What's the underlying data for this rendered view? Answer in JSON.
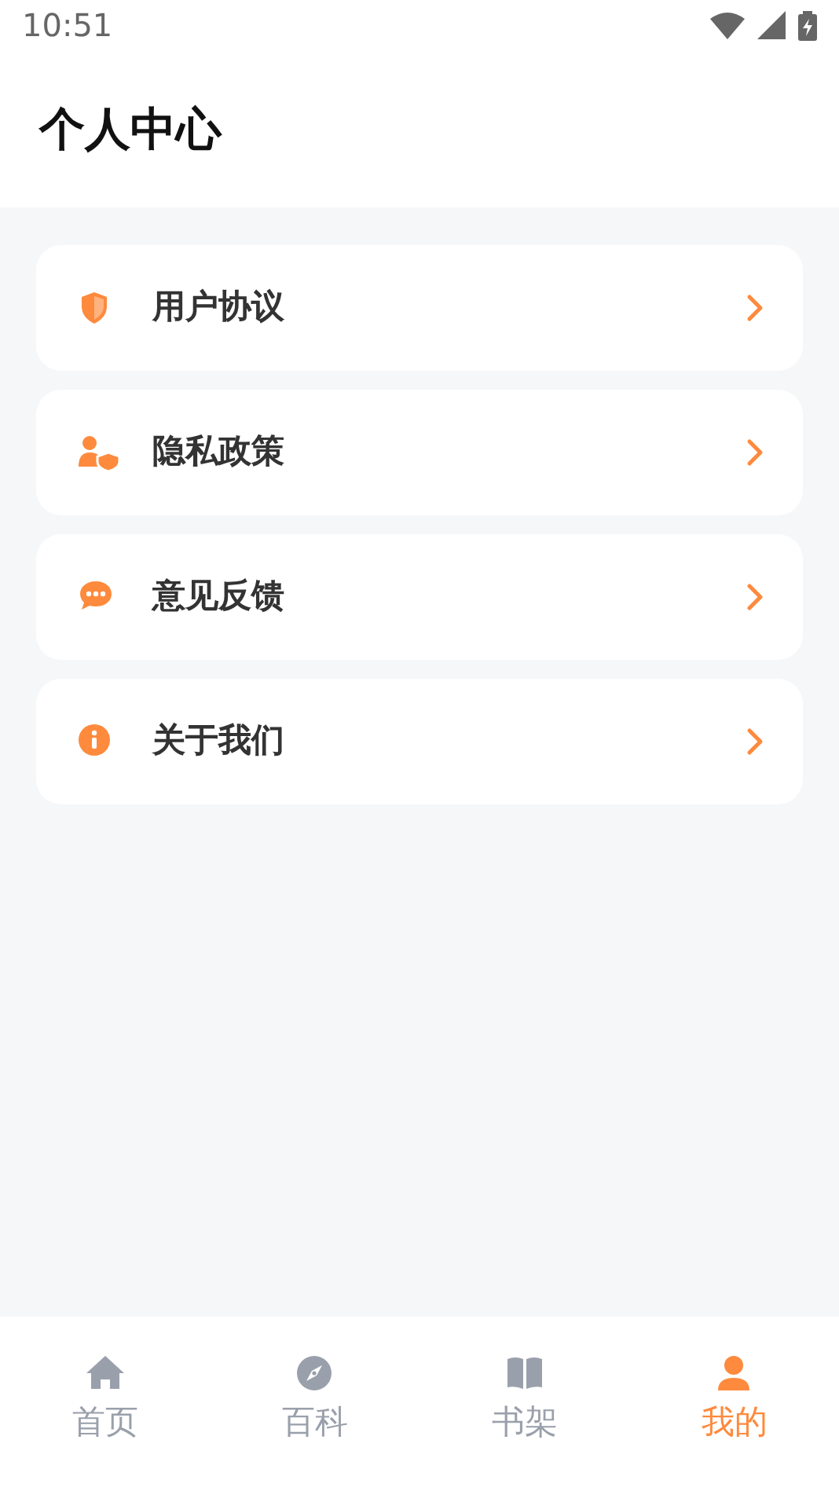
{
  "status_bar": {
    "time": "10:51"
  },
  "header": {
    "title": "个人中心"
  },
  "menu": [
    {
      "kind": "shield",
      "label": "用户协议"
    },
    {
      "kind": "user-shield",
      "label": "隐私政策"
    },
    {
      "kind": "chat",
      "label": "意见反馈"
    },
    {
      "kind": "info",
      "label": "关于我们"
    }
  ],
  "tab_bar": [
    {
      "kind": "home",
      "label": "首页",
      "selected": false
    },
    {
      "kind": "compass",
      "label": "百科",
      "selected": false
    },
    {
      "kind": "book",
      "label": "书架",
      "selected": false
    },
    {
      "kind": "person",
      "label": "我的",
      "selected": true
    }
  ]
}
